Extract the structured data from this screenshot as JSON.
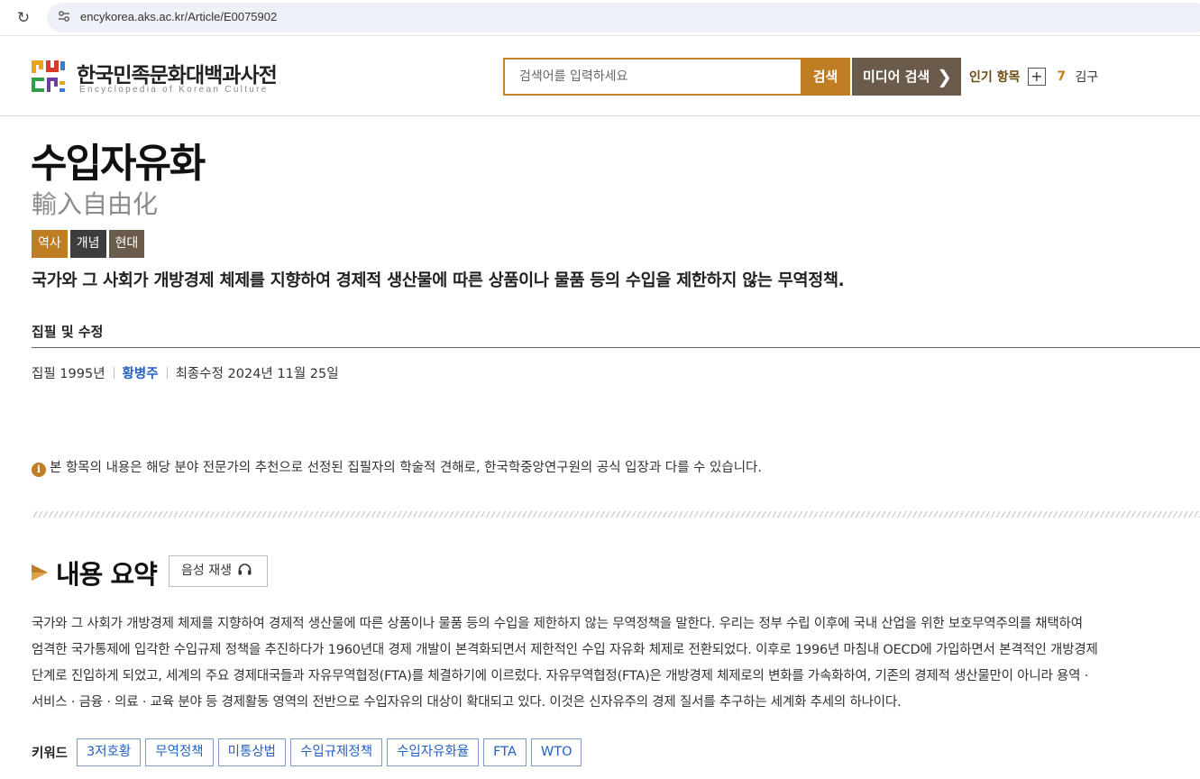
{
  "browser": {
    "url": "encykorea.aks.ac.kr/Article/E0075902"
  },
  "header": {
    "logo_title": "한국민족문화대백과사전",
    "logo_subtitle": "Encyclopedia of Korean Culture",
    "search_placeholder": "검색어를 입력하세요",
    "search_button": "검색",
    "media_search_button": "미디어 검색",
    "popular_label": "인기 항목",
    "popular_plus": "+",
    "popular_rank": "7",
    "popular_item": "김구"
  },
  "article": {
    "title": "수입자유화",
    "hanja": "輸入自由化",
    "tags": [
      "역사",
      "개념",
      "현대"
    ],
    "definition": "국가와 그 사회가 개방경제 체제를 지향하여 경제적 생산물에 따른 상품이나 물품 등의 수입을 제한하지 않는 무역정책."
  },
  "writer": {
    "heading": "집필 및 수정",
    "written": "집필 1995년",
    "author": "황병주",
    "modified": "최종수정 2024년 11월 25일"
  },
  "notice": {
    "icon_glyph": "i",
    "text": "본 항목의 내용은 해당 분야 전문가의 추천으로 선정된 집필자의 학술적 견해로, 한국학중앙연구원의 공식 입장과 다를 수 있습니다."
  },
  "summary": {
    "title": "내용 요약",
    "audio_button": "음성 재생",
    "lines": [
      "국가와 그 사회가 개방경제 체제를 지향하여 경제적 생산물에 따른 상품이나 물품 등의 수입을 제한하지 않는 무역정책을 말한다. 우리는 정부 수립 이후에 국내 산업을 위한 보호무역주의를 채택하여",
      "엄격한 국가통제에 입각한 수입규제 정책을 추진하다가 1960년대 경제 개발이 본격화되면서 제한적인 수입 자유화 체제로 전환되었다. 이후로 1996년 마침내 OECD에 가입하면서 본격적인 개방경제",
      "단계로 진입하게 되었고, 세계의 주요 경제대국들과 자유무역협정(FTA)를 체결하기에 이르렀다. 자유무역협정(FTA)은 개방경제 체제로의 변화를 가속화하여, 기존의 경제적 생산물만이 아니라 용역 ·",
      "서비스 · 금융 · 의료 · 교육 분야 등 경제활동 영역의 전반으로 수입자유의 대상이 확대되고 있다. 이것은 신자유주의 경제 질서를 추구하는 세계화 추세의 하나이다."
    ]
  },
  "keywords": {
    "label": "키워드",
    "items": [
      "3저호황",
      "무역정책",
      "미통상법",
      "수입규제정책",
      "수입자유화율",
      "FTA",
      "WTO"
    ]
  },
  "colors": {
    "accent": "#c07e24",
    "media_brown": "#6a5b4a",
    "tag_dark": "#3d3d3d",
    "link_blue": "#2461c2"
  },
  "icons": {
    "reload": "reload-icon",
    "site_info": "site-info-icon",
    "chevron": "chevron-right-icon",
    "info": "info-icon",
    "play": "play-icon",
    "headphone": "headphone-icon"
  }
}
